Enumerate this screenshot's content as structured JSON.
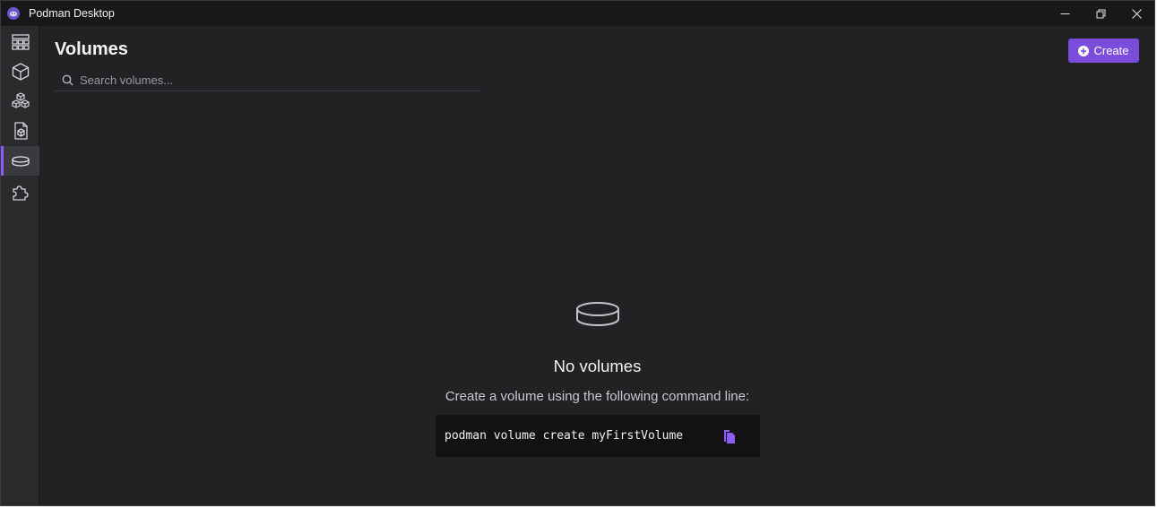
{
  "window": {
    "title": "Podman Desktop"
  },
  "sidebar": {
    "items": [
      {
        "icon": "dashboard-icon",
        "active": false
      },
      {
        "icon": "containers-icon",
        "active": false
      },
      {
        "icon": "pods-icon",
        "active": false
      },
      {
        "icon": "images-icon",
        "active": false
      },
      {
        "icon": "volumes-icon",
        "active": true
      },
      {
        "icon": "extensions-icon",
        "active": false
      }
    ]
  },
  "header": {
    "title": "Volumes",
    "create_label": "Create"
  },
  "search": {
    "placeholder": "Search volumes..."
  },
  "empty_state": {
    "icon": "volume-icon",
    "title": "No volumes",
    "description": "Create a volume using the following command line:",
    "command": "podman volume create myFirstVolume",
    "copy_icon": "copy-icon"
  },
  "colors": {
    "accent": "#7c4ddb",
    "background": "#222224",
    "sidebar": "#2a2a2c",
    "titlebar": "#18181a",
    "command_bg": "#121214"
  }
}
